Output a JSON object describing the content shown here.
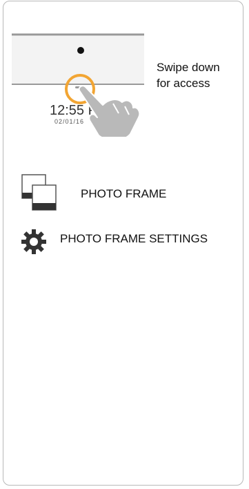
{
  "hint": {
    "line1": "Swipe down",
    "line2": "for access"
  },
  "screen_preview": {
    "time": "12:55 P",
    "date": "02/01/16"
  },
  "menu": {
    "photo_frame": {
      "label": "PHOTO FRAME",
      "icon": "photo-frame-icon"
    },
    "photo_frame_settings": {
      "label": "PHOTO FRAME SETTINGS",
      "icon": "gear-icon"
    }
  },
  "colors": {
    "accent": "#f2a533",
    "border": "#b8b8b8",
    "preview_bg": "#f3f3f3",
    "text": "#111111"
  }
}
